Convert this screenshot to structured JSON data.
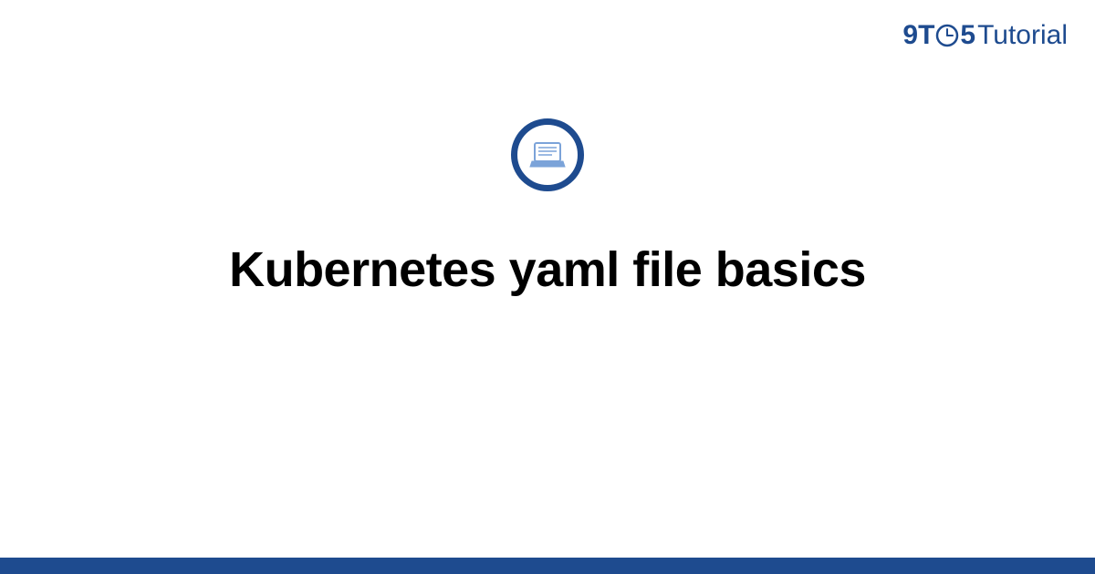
{
  "logo": {
    "nine": "9",
    "t": "T",
    "five": "5",
    "tutorial": "Tutorial"
  },
  "title": "Kubernetes yaml file basics",
  "colors": {
    "brand": "#1e4b8f",
    "iconFill": "#7ba3d9"
  }
}
